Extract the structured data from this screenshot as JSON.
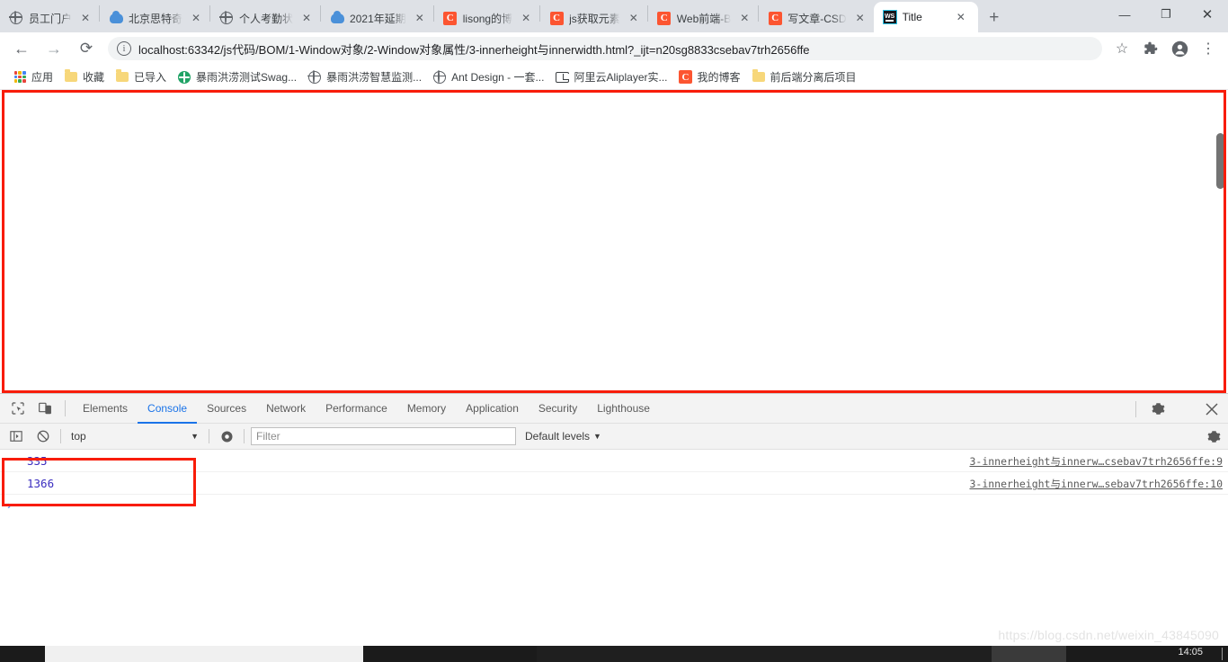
{
  "window": {
    "controls": {
      "minimize": "—",
      "maximize": "❐",
      "close": "✕"
    }
  },
  "tabs": [
    {
      "title": "员工门户",
      "favicon": "globe-icon",
      "active": false,
      "close": "✕"
    },
    {
      "title": "北京思特奇",
      "favicon": "cloud-icon",
      "active": false,
      "close": "✕"
    },
    {
      "title": "个人考勤状",
      "favicon": "globe-icon",
      "active": false,
      "close": "✕"
    },
    {
      "title": "2021年延期",
      "favicon": "cloud-icon",
      "active": false,
      "close": "✕"
    },
    {
      "title": "lisong的博",
      "favicon": "csdn-icon",
      "active": false,
      "close": "✕"
    },
    {
      "title": "js获取元素",
      "favicon": "csdn-icon",
      "active": false,
      "close": "✕"
    },
    {
      "title": "Web前端-B",
      "favicon": "csdn-icon",
      "active": false,
      "close": "✕"
    },
    {
      "title": "写文章-CSD",
      "favicon": "csdn-icon",
      "active": false,
      "close": "✕"
    },
    {
      "title": "Title",
      "favicon": "webstorm-icon",
      "active": true,
      "close": "✕"
    }
  ],
  "newtab_label": "+",
  "toolbar": {
    "back": "←",
    "forward": "→",
    "reload": "⟳",
    "info_icon": "ⓘ",
    "url": "localhost:63342/js代码/BOM/1-Window对象/2-Window对象属性/3-innerheight与innerwidth.html?_ijt=n20sg8833csebav7trh2656ffe",
    "bookmark_star": "☆",
    "extensions": "🧩",
    "profile": "account-icon",
    "menu": "⋮"
  },
  "bookmarks": [
    {
      "label": "应用",
      "icon": "apps-grid-icon"
    },
    {
      "label": "收藏",
      "icon": "folder-icon"
    },
    {
      "label": "已导入",
      "icon": "folder-icon"
    },
    {
      "label": "暴雨洪涝测试Swag...",
      "icon": "swagger-green-icon"
    },
    {
      "label": "暴雨洪涝智慧监测...",
      "icon": "globe-icon"
    },
    {
      "label": "Ant Design - 一套...",
      "icon": "globe-icon"
    },
    {
      "label": "阿里云Aliplayer实...",
      "icon": "aliplayer-icon"
    },
    {
      "label": "我的博客",
      "icon": "csdn-icon"
    },
    {
      "label": "前后端分离后项目",
      "icon": "folder-icon"
    }
  ],
  "devtools": {
    "inspect_icon": "inspect-cursor-icon",
    "device_icon": "device-toolbar-icon",
    "tabs": [
      {
        "label": "Elements",
        "selected": false
      },
      {
        "label": "Console",
        "selected": true
      },
      {
        "label": "Sources",
        "selected": false
      },
      {
        "label": "Network",
        "selected": false
      },
      {
        "label": "Performance",
        "selected": false
      },
      {
        "label": "Memory",
        "selected": false
      },
      {
        "label": "Application",
        "selected": false
      },
      {
        "label": "Security",
        "selected": false
      },
      {
        "label": "Lighthouse",
        "selected": false
      }
    ],
    "settings_icon": "gear-icon",
    "more_icon": "kebab-menu-icon",
    "close_icon": "close-icon",
    "filterbar": {
      "sidebar_toggle": "console-sidebar-icon",
      "clear_icon": "clear-console-icon",
      "context": "top",
      "context_caret": "▼",
      "eye_icon": "live-expression-icon",
      "filter_placeholder": "Filter",
      "filter_value": "",
      "levels_label": "Default levels",
      "levels_caret": "▼",
      "settings_icon": "gear-icon"
    },
    "console_rows": [
      {
        "value": "335",
        "source": "3-innerheight与innerw…csebav7trh2656ffe:9"
      },
      {
        "value": "1366",
        "source": "3-innerheight与innerw…sebav7trh2656ffe:10"
      }
    ],
    "prompt_caret": "›"
  },
  "highlights": {
    "page_box_color": "#f81c09",
    "console_box_color": "#f81c09"
  },
  "watermark": "https://blog.csdn.net/weixin_43845090",
  "taskbar": {
    "clock": "14:05"
  },
  "colors": {
    "accent": "#1a73e8",
    "tabstrip_bg": "#dee1e6",
    "console_value": "#3b2ec0",
    "highlight_red": "#f81c09"
  }
}
